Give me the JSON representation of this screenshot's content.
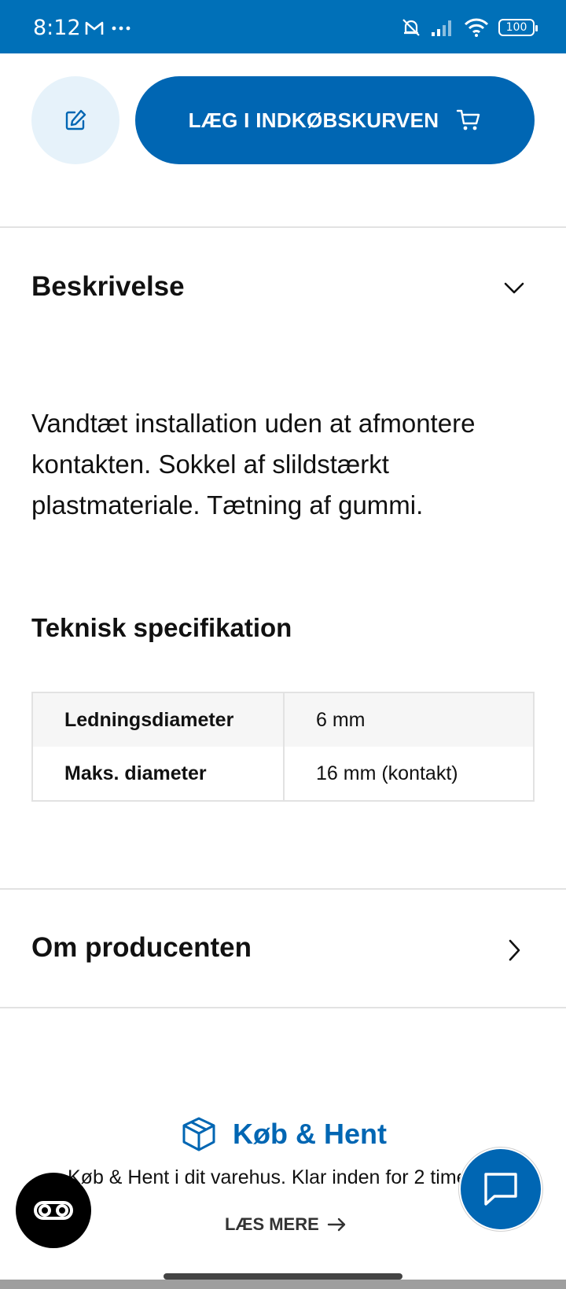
{
  "status_bar": {
    "time": "8:12",
    "battery": "100",
    "icons": [
      "gmail-icon",
      "more-dots-icon",
      "bell-off-icon",
      "signal-icon",
      "wifi-icon",
      "battery-icon"
    ]
  },
  "actions": {
    "edit_icon": "edit-icon",
    "cart_button_label": "LÆG I INDKØBSKURVEN",
    "cart_icon": "cart-icon"
  },
  "description": {
    "title": "Beskrivelse",
    "text": "Vandtæt installation uden at afmontere kontakten. Sokkel af slildstærkt plastmateriale. Tætning af gummi."
  },
  "specs": {
    "title": "Teknisk specifikation",
    "rows": [
      {
        "label": "Ledningsdiameter",
        "value": "6 mm"
      },
      {
        "label": "Maks. diameter",
        "value": "16 mm (kontakt)"
      }
    ]
  },
  "manufacturer": {
    "title": "Om producenten"
  },
  "promo": {
    "title": "Køb & Hent",
    "subtitle": "Køb & Hent i dit varehus. Klar inden for 2 timer",
    "link_label": "LÆS MERE"
  },
  "colors": {
    "brand_blue": "#0066b3",
    "status_bar": "#0070b8"
  }
}
